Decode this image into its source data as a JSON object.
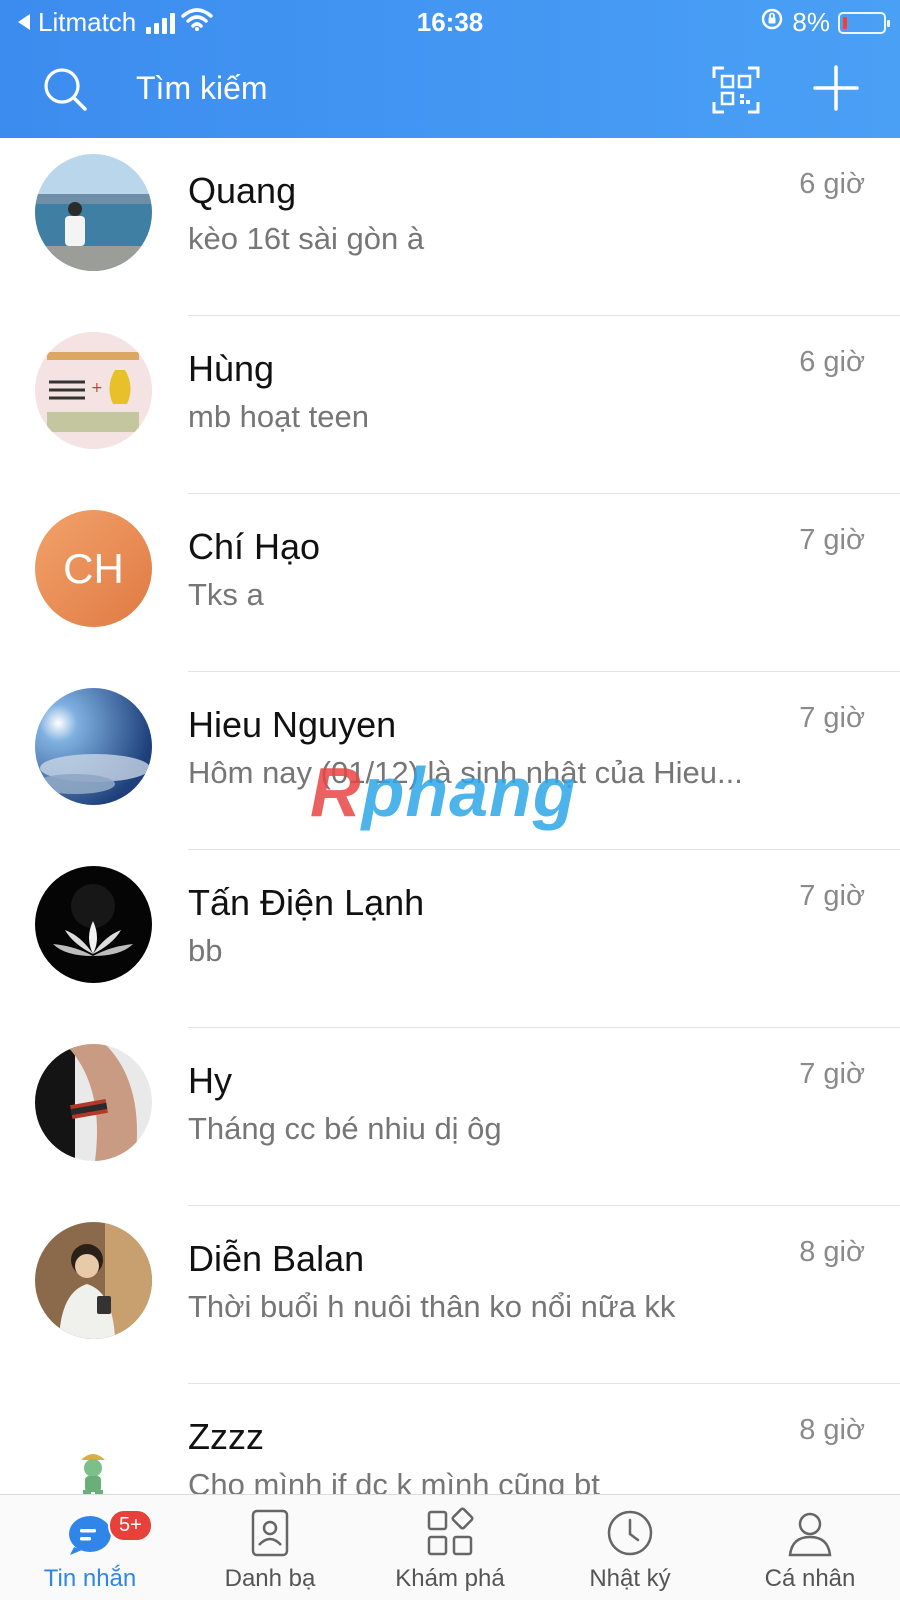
{
  "status_bar": {
    "carrier": "Litmatch",
    "time": "16:38",
    "battery": "8%"
  },
  "header": {
    "search_label": "Tìm kiếm",
    "icons": [
      "search-icon",
      "qr-code-icon",
      "plus-icon"
    ]
  },
  "conversations": [
    {
      "name": "Quang",
      "preview": "kèo 16t sài gòn à",
      "time": "6 giờ",
      "avatar": "photo"
    },
    {
      "name": "Hùng",
      "preview": "mb hoạt teen",
      "time": "6 giờ",
      "avatar": "photo"
    },
    {
      "name": "Chí Hạo",
      "preview": "Tks a",
      "time": "7 giờ",
      "avatar": "initials",
      "initials": "CH"
    },
    {
      "name": "Hieu Nguyen",
      "preview": "Hôm nay (01/12) là sinh nhật của Hieu...",
      "time": "7 giờ",
      "avatar": "photo"
    },
    {
      "name": "Tấn Điện Lạnh",
      "preview": "bb",
      "time": "7 giờ",
      "avatar": "photo"
    },
    {
      "name": "Hy",
      "preview": "Tháng cc bé nhiu dị ôg",
      "time": "7 giờ",
      "avatar": "photo"
    },
    {
      "name": "Diễn Balan",
      "preview": "Thời buổi h nuôi thân ko nổi nữa kk",
      "time": "8 giờ",
      "avatar": "photo"
    },
    {
      "name": "Zzzz",
      "preview": "Cho mình if dc k mình cũng bt",
      "time": "8 giờ",
      "avatar": "sticker"
    }
  ],
  "watermark": {
    "text_r": "R",
    "text_rest": "phang"
  },
  "tabbar": {
    "tabs": [
      {
        "label": "Tin nhắn",
        "icon": "chat-icon",
        "active": true,
        "badge": "5+"
      },
      {
        "label": "Danh bạ",
        "icon": "contacts-icon",
        "active": false
      },
      {
        "label": "Khám phá",
        "icon": "discover-icon",
        "active": false
      },
      {
        "label": "Nhật ký",
        "icon": "clock-icon",
        "active": false
      },
      {
        "label": "Cá nhân",
        "icon": "person-icon",
        "active": false
      }
    ]
  },
  "colors": {
    "header_blue": "#3c8cef",
    "active_tab": "#2f86e8",
    "badge_red": "#e8413b"
  }
}
